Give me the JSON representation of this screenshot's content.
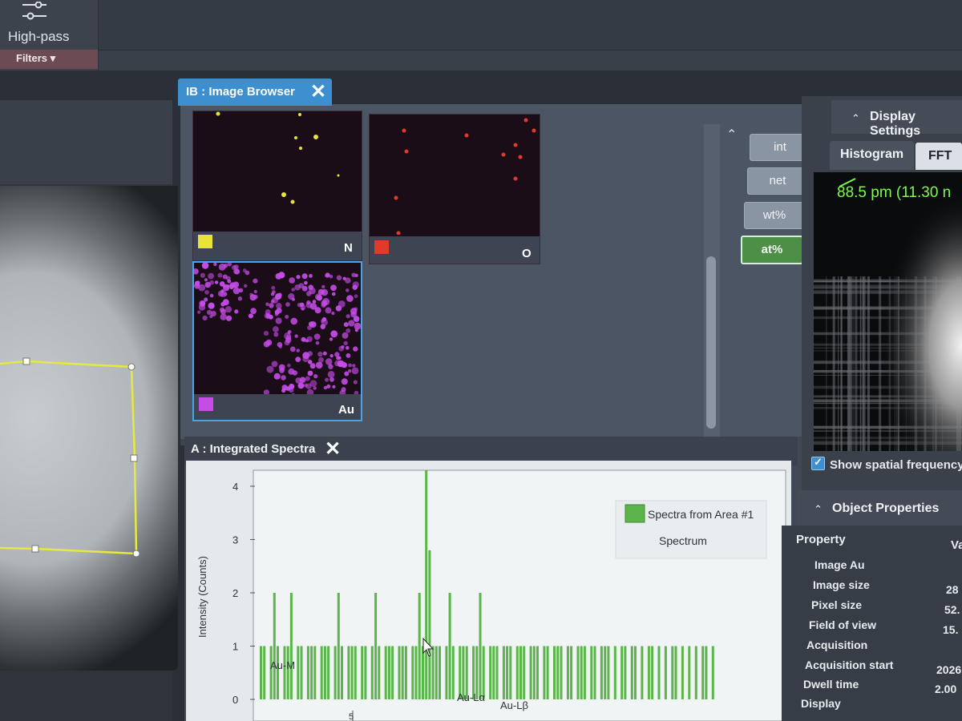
{
  "toolbar": {
    "highpass_label": "High-pass",
    "filters_label": "Filters ▾"
  },
  "image_browser": {
    "tab_title": "IB : Image Browser",
    "close": "✕",
    "thumbnails": [
      {
        "element": "N",
        "color": "#e8e23a"
      },
      {
        "element": "O",
        "color": "#e03a2a"
      },
      {
        "element": "Au",
        "color": "#c64ce8"
      }
    ],
    "modes": [
      "int",
      "net",
      "wt%",
      "at%"
    ],
    "active_mode": "at%",
    "scroll_up": "⌃",
    "scroll_down": "⌄"
  },
  "spectra": {
    "tab_title": "A : Integrated Spectra",
    "close": "✕",
    "legend_series": "Spectra from Area #1",
    "legend_caption": "Spectrum",
    "series_color": "#5bb54a"
  },
  "chart_data": {
    "type": "bar",
    "ylabel": "Intensity (Counts)",
    "yticks": [
      "0",
      "1",
      "2",
      "3",
      "4"
    ],
    "ylim": [
      0,
      4.3
    ],
    "xticks": [
      "5"
    ],
    "annotations": [
      "Au-M",
      "Au-Lα",
      "Au-Lβ"
    ],
    "series": [
      {
        "name": "Spectra from Area #1",
        "values": [
          1,
          1,
          0,
          1,
          2,
          1,
          0,
          1,
          1,
          2,
          0,
          1,
          1,
          0,
          1,
          1,
          1,
          0,
          1,
          1,
          1,
          0,
          1,
          2,
          1,
          0,
          1,
          1,
          1,
          0,
          1,
          1,
          0,
          1,
          2,
          1,
          0,
          1,
          1,
          1,
          0,
          1,
          1,
          1,
          0,
          1,
          1,
          2,
          1,
          4.3,
          2.8,
          1,
          1,
          1,
          0,
          1,
          2,
          1,
          0,
          1,
          1,
          1,
          0,
          1,
          1,
          2,
          1,
          0,
          1,
          1,
          1,
          0,
          1,
          1,
          1,
          0,
          1,
          1,
          1,
          0,
          1,
          1,
          1,
          0,
          1,
          1,
          0,
          1,
          1,
          1,
          0,
          1,
          1,
          0,
          1,
          1,
          1,
          0,
          1,
          1,
          0,
          1,
          1,
          1,
          0,
          1,
          0,
          1,
          1,
          0,
          1,
          1,
          0,
          1,
          0,
          1,
          1,
          0,
          1,
          0,
          1,
          0,
          1,
          1,
          0,
          1,
          0,
          1,
          0,
          1,
          0,
          1,
          1,
          0,
          1
        ]
      }
    ]
  },
  "display_settings": {
    "title": "Display Settings",
    "chevron": "⌃",
    "tab_histogram": "Histogram",
    "tab_fft": "FFT",
    "fft_readout": "88.5 pm (11.30 n",
    "checkbox_label": "Show spatial frequency",
    "checkbox_mark": "✓"
  },
  "object_properties": {
    "title": "Object Properties",
    "chevron": "⌃",
    "col_property": "Property",
    "col_value": "Va",
    "rows": [
      {
        "name": "Image Au",
        "value": ""
      },
      {
        "name": "Image size",
        "value": "28"
      },
      {
        "name": "Pixel size",
        "value": "52."
      },
      {
        "name": "Field of view",
        "value": "15."
      },
      {
        "name": "Acquisition",
        "value": ""
      },
      {
        "name": "Acquisition start",
        "value": "2026"
      },
      {
        "name": "Dwell time",
        "value": "2.00"
      },
      {
        "name": "Display",
        "value": ""
      }
    ]
  }
}
